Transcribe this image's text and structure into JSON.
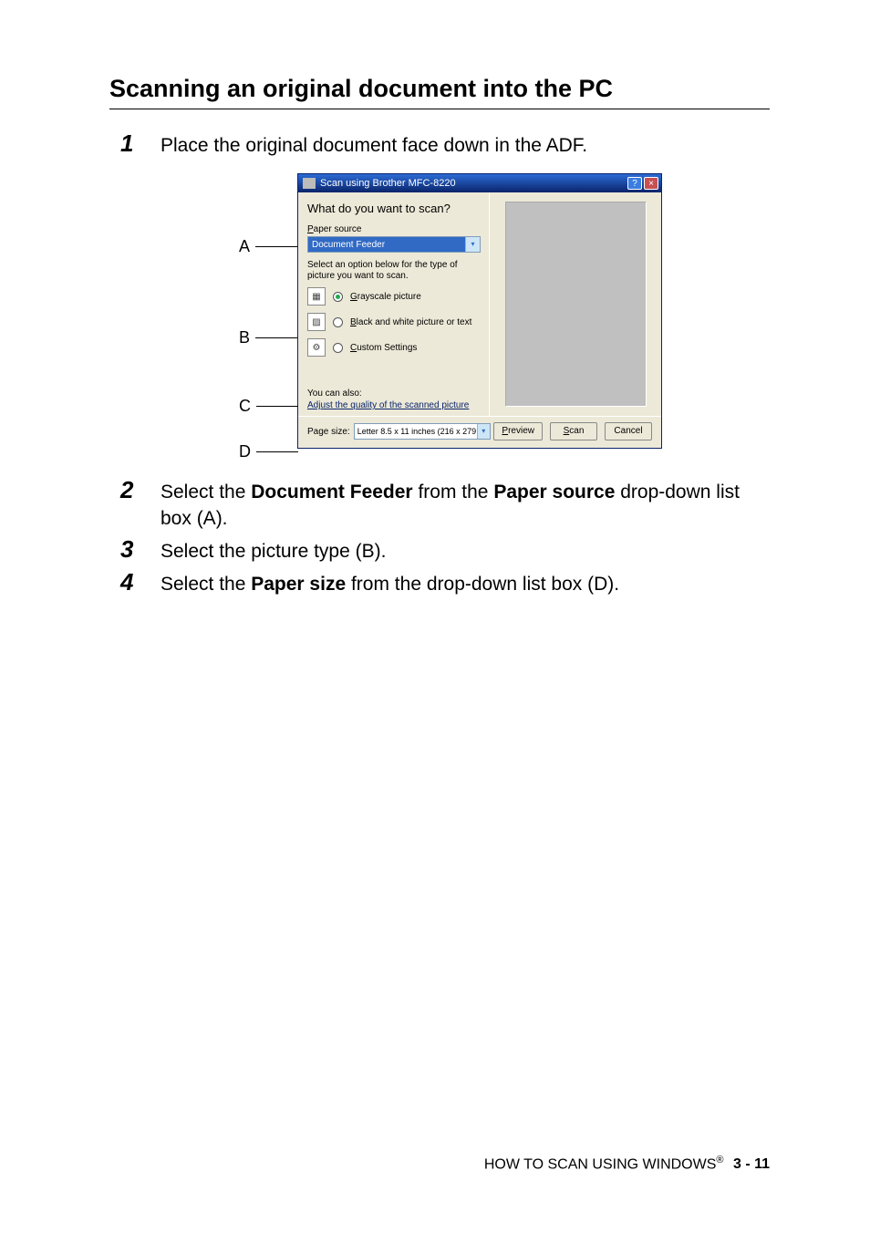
{
  "heading": "Scanning an original document into the PC",
  "steps": [
    {
      "num": "1",
      "text": "Place the original document face down in the ADF."
    },
    {
      "num": "2",
      "text": "Select the <b>Document Feeder</b> from the <b>Paper source</b> drop-down list box (A)."
    },
    {
      "num": "3",
      "text": "Select the picture type (B)."
    },
    {
      "num": "4",
      "text": "Select the <b>Paper size</b> from the drop-down list box (D)."
    }
  ],
  "labels": {
    "a": "A",
    "b": "B",
    "c": "C",
    "d": "D"
  },
  "dialog": {
    "title": "Scan using Brother MFC-8220",
    "question": "What do you want to scan?",
    "paper_source_label": "Paper source",
    "paper_source_value": "Document Feeder",
    "instruction": "Select an option below for the type of picture you want to scan.",
    "options": {
      "gray": "Grayscale picture",
      "bw": "Black and white picture or text",
      "custom": "Custom Settings"
    },
    "you_can": "You can also:",
    "adjust_link": "Adjust the quality of the scanned picture",
    "page_size_label": "Page size:",
    "page_size_value": "Letter 8.5 x 11 inches (216 x 279",
    "preview_btn": "Preview",
    "scan_btn": "Scan",
    "cancel_btn": "Cancel"
  },
  "footer": {
    "text": "HOW TO SCAN USING WINDOWS",
    "reg": "®",
    "page": "3 - 11"
  }
}
